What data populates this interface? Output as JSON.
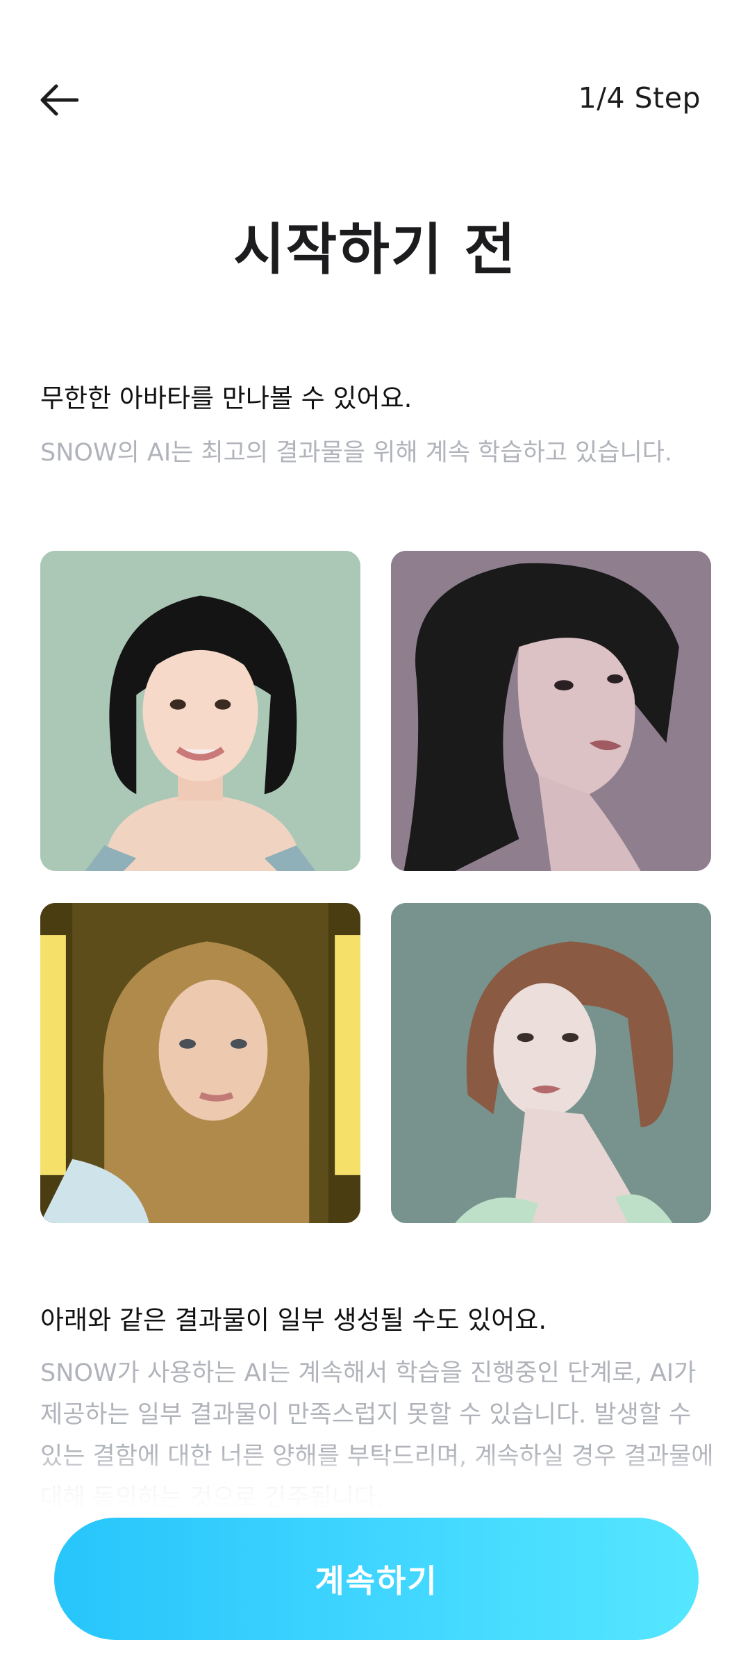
{
  "header": {
    "back_icon": "arrow-left-icon",
    "step_text": "1/4 Step"
  },
  "title": "시작하기 전",
  "section1": {
    "heading": "무한한 아바타를 만나볼 수 있어요.",
    "body": "SNOW의 AI는 최고의 결과물을 위해 계속 학습하고 있습니다."
  },
  "avatars": [
    {
      "description": "avatar-black-bob-smiling"
    },
    {
      "description": "avatar-dark-hair-profile"
    },
    {
      "description": "avatar-blonde-hair"
    },
    {
      "description": "avatar-auburn-short-hair"
    }
  ],
  "section2": {
    "heading": "아래와 같은 결과물이 일부 생성될 수도 있어요.",
    "body": "SNOW가 사용하는 AI는 계속해서 학습을 진행중인 단계로, AI가 제공하는 일부 결과물이 만족스럽지 못할 수 있습니다. 발생할 수 있는 결함에 대한 너른 양해를 부탁드리며, 계속하실 경우 결과물에 대해 동의하는 것으로 간주됩니다."
  },
  "continue_button": "계속하기",
  "colors": {
    "button_start": "#27c5fb",
    "button_end": "#55e6ff",
    "muted_text": "#b0b3ba"
  }
}
